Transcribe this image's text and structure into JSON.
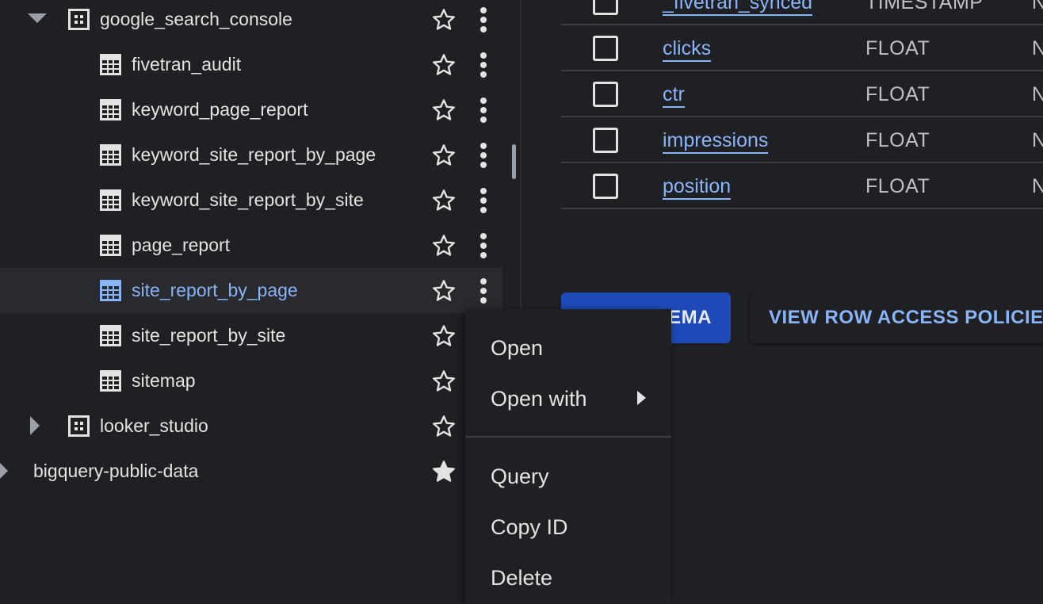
{
  "explorer": {
    "items": [
      {
        "label": "google_search_console",
        "type": "dataset",
        "expanded": true,
        "starred": false
      },
      {
        "label": "fivetran_audit",
        "type": "table",
        "starred": false
      },
      {
        "label": "keyword_page_report",
        "type": "table",
        "starred": false
      },
      {
        "label": "keyword_site_report_by_page",
        "type": "table",
        "starred": false
      },
      {
        "label": "keyword_site_report_by_site",
        "type": "table",
        "starred": false
      },
      {
        "label": "page_report",
        "type": "table",
        "starred": false
      },
      {
        "label": "site_report_by_page",
        "type": "table",
        "starred": false,
        "selected": true
      },
      {
        "label": "site_report_by_site",
        "type": "table",
        "starred": false
      },
      {
        "label": "sitemap",
        "type": "table",
        "starred": false
      },
      {
        "label": "looker_studio",
        "type": "dataset",
        "expanded": false,
        "starred": false
      },
      {
        "label": "bigquery-public-data",
        "type": "project",
        "expanded": false,
        "starred": true
      }
    ]
  },
  "schema": {
    "fields": [
      {
        "name": "_fivetran_synced",
        "type": "TIMESTAMP",
        "mode": "N"
      },
      {
        "name": "clicks",
        "type": "FLOAT",
        "mode": "N"
      },
      {
        "name": "ctr",
        "type": "FLOAT",
        "mode": "N"
      },
      {
        "name": "impressions",
        "type": "FLOAT",
        "mode": "N"
      },
      {
        "name": "position",
        "type": "FLOAT",
        "mode": "N"
      }
    ],
    "edit_schema_label": "EDIT SCHEMA",
    "row_access_label": "VIEW ROW ACCESS POLICIES"
  },
  "context_menu": {
    "open": "Open",
    "open_with": "Open with",
    "query": "Query",
    "copy_id": "Copy ID",
    "delete": "Delete"
  },
  "colors": {
    "background": "#1f2023",
    "selected_row": "#292a2d",
    "link_blue": "#8ab4f8",
    "primary_button": "#1e4ab8"
  }
}
